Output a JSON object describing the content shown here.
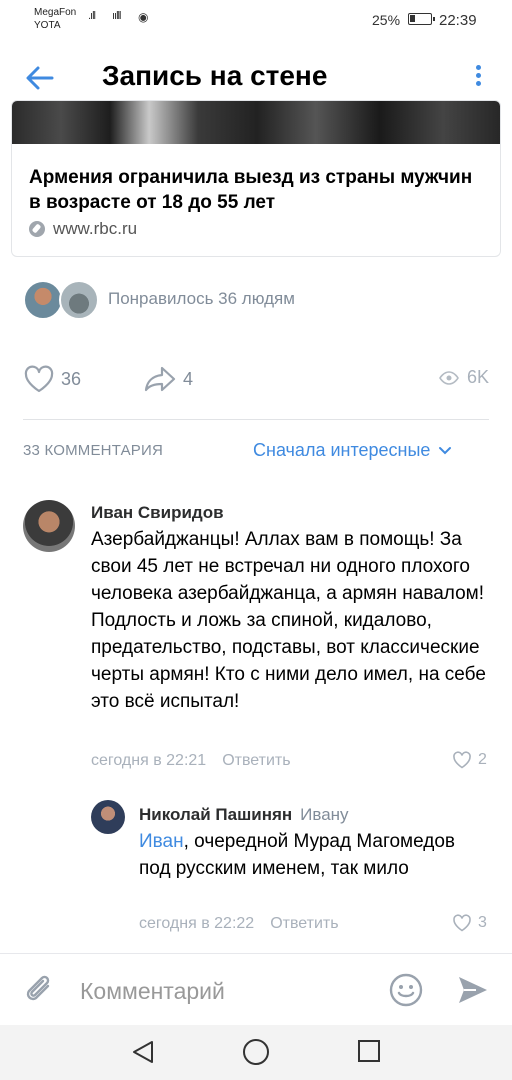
{
  "status_bar": {
    "carrier_line1": "MegaFon",
    "carrier_line2": "YOTA",
    "battery_percent": "25%",
    "battery_level": 0.25,
    "time": "22:39"
  },
  "header": {
    "title": "Запись на стене",
    "back_icon": "arrow-left-icon",
    "menu_icon": "more-vertical-icon"
  },
  "link_card": {
    "title": "Армения ограничила выезд из страны мужчин в возрасте от 18 до 55 лет",
    "source": "www.rbc.ru"
  },
  "likes_summary": {
    "text": "Понравилось 36 людям"
  },
  "actions": {
    "likes": "36",
    "shares": "4",
    "views": "6K"
  },
  "comments_header": {
    "count_label": "33 КОММЕНТАРИЯ",
    "sort_label": "Сначала интересные"
  },
  "comments": [
    {
      "author": "Иван Свиридов",
      "text": "Азербайджанцы! Аллах вам в помощь! За свои 45 лет не встречал ни одного плохого человека азербайджанца, а армян навалом! Подлость и ложь за спиной, кидалово, предательство, подставы, вот классические черты армян! Кто с ними дело имел, на себе это всё испытал!",
      "time": "сегодня в 22:21",
      "reply_label": "Ответить",
      "likes": "2"
    },
    {
      "author": "Николай Пашинян",
      "reply_to": "Ивану",
      "mention": "Иван",
      "text": ", очередной Мурад Магомедов под русским именем, так мило",
      "time": "сегодня в 22:22",
      "reply_label": "Ответить",
      "likes": "3"
    }
  ],
  "comment_input": {
    "placeholder": "Комментарий"
  },
  "colors": {
    "accent": "#3f8ae0",
    "secondary_text": "#818c99",
    "meta_text": "#a9b1bb"
  }
}
